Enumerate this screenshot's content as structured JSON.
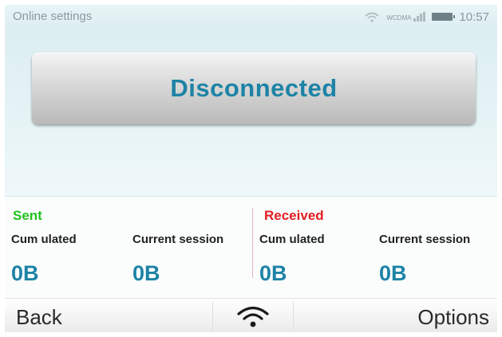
{
  "status_bar": {
    "title": "Online settings",
    "signal_label": "WCDMA",
    "time": "10:57",
    "icons": [
      "wifi-icon",
      "signal-icon",
      "battery-icon"
    ]
  },
  "main": {
    "connection_button_label": "Disconnected"
  },
  "stats": {
    "sent": {
      "heading": "Sent",
      "cumulated_label": "Cum ulated",
      "current_label": "Current session",
      "cumulated_value": "0B",
      "current_value": "0B"
    },
    "received": {
      "heading": "Received",
      "cumulated_label": "Cum ulated",
      "current_label": "Current session",
      "cumulated_value": "0B",
      "current_value": "0B"
    }
  },
  "softkeys": {
    "left_label": "Back",
    "center_icon": "wifi-icon",
    "right_label": "Options"
  },
  "colors": {
    "accent": "#1d83a5",
    "sent": "#22c21e",
    "received": "#e41e22"
  }
}
